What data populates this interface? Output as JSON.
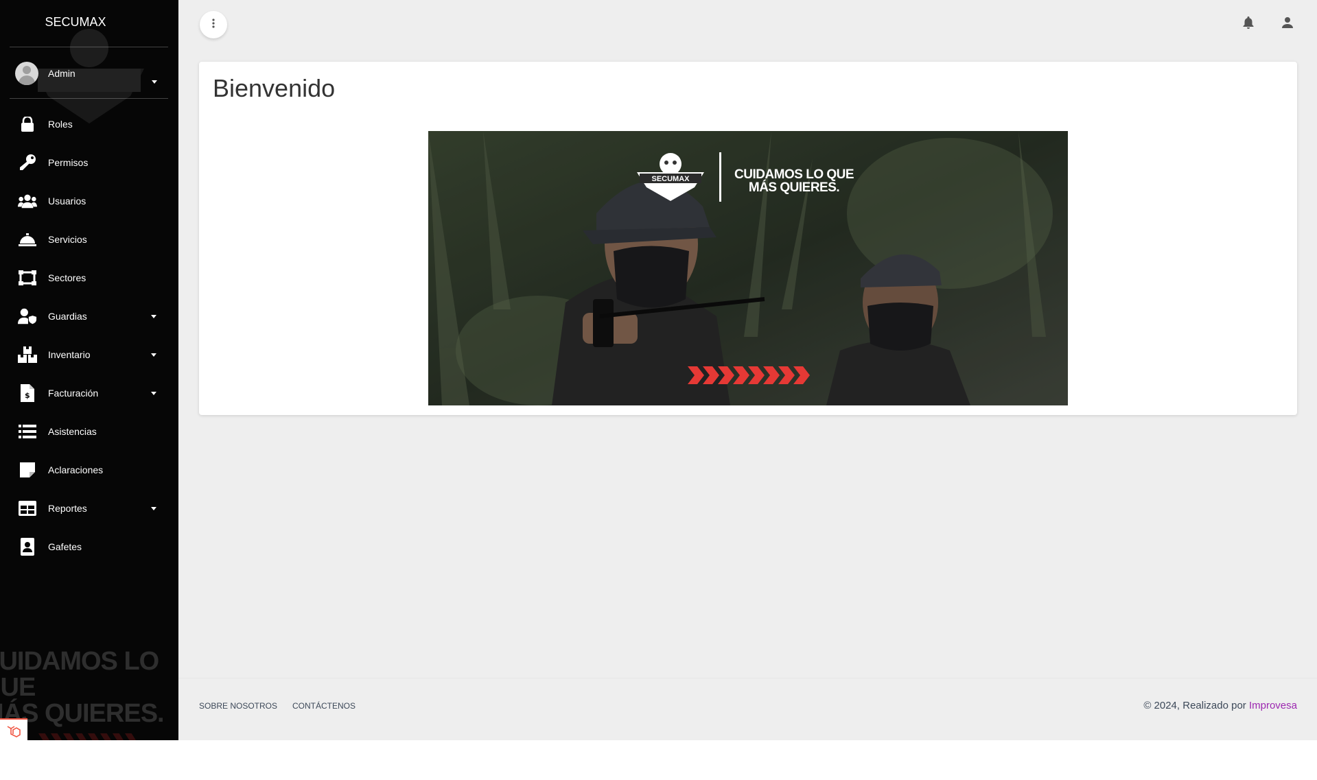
{
  "brand": {
    "name": "SECUMAX"
  },
  "sidebar": {
    "user": {
      "name": "Admin",
      "icon": "avatar-icon"
    },
    "watermark": {
      "logo_text": "SECUMAX",
      "slogan_line1": "CUIDAMOS LO QUE",
      "slogan_line2": "MÁS QUIERES."
    },
    "items": [
      {
        "label": "Roles",
        "icon": "lock-icon",
        "has_submenu": false
      },
      {
        "label": "Permisos",
        "icon": "key-icon",
        "has_submenu": false
      },
      {
        "label": "Usuarios",
        "icon": "users-icon",
        "has_submenu": false
      },
      {
        "label": "Servicios",
        "icon": "service-bell-icon",
        "has_submenu": false
      },
      {
        "label": "Sectores",
        "icon": "sector-icon",
        "has_submenu": false
      },
      {
        "label": "Guardias",
        "icon": "guard-icon",
        "has_submenu": true
      },
      {
        "label": "Inventario",
        "icon": "boxes-icon",
        "has_submenu": true
      },
      {
        "label": "Facturación",
        "icon": "invoice-icon",
        "has_submenu": true
      },
      {
        "label": "Asistencias",
        "icon": "list-icon",
        "has_submenu": false
      },
      {
        "label": "Aclaraciones",
        "icon": "note-icon",
        "has_submenu": false
      },
      {
        "label": "Reportes",
        "icon": "table-icon",
        "has_submenu": true
      },
      {
        "label": "Gafetes",
        "icon": "badge-icon",
        "has_submenu": false
      }
    ]
  },
  "topbar": {
    "menu_icon": "more-vert-icon",
    "notifications_icon": "bell-icon",
    "profile_icon": "person-icon"
  },
  "main": {
    "title": "Bienvenido",
    "banner": {
      "logo_text": "SECUMAX",
      "slogan_line1": "CUIDAMOS LO QUE",
      "slogan_line2": "MÁS QUIERES."
    }
  },
  "footer": {
    "links": [
      "SOBRE NOSOTROS",
      "CONTÁCTENOS"
    ],
    "copyright_prefix": "© 2024, Realizado por ",
    "copyright_link": "Improvesa"
  },
  "colors": {
    "sidebar_bg": "#060606",
    "page_bg": "#eeeeee",
    "accent_link": "#9c27b0",
    "banner_red": "#e53935"
  }
}
